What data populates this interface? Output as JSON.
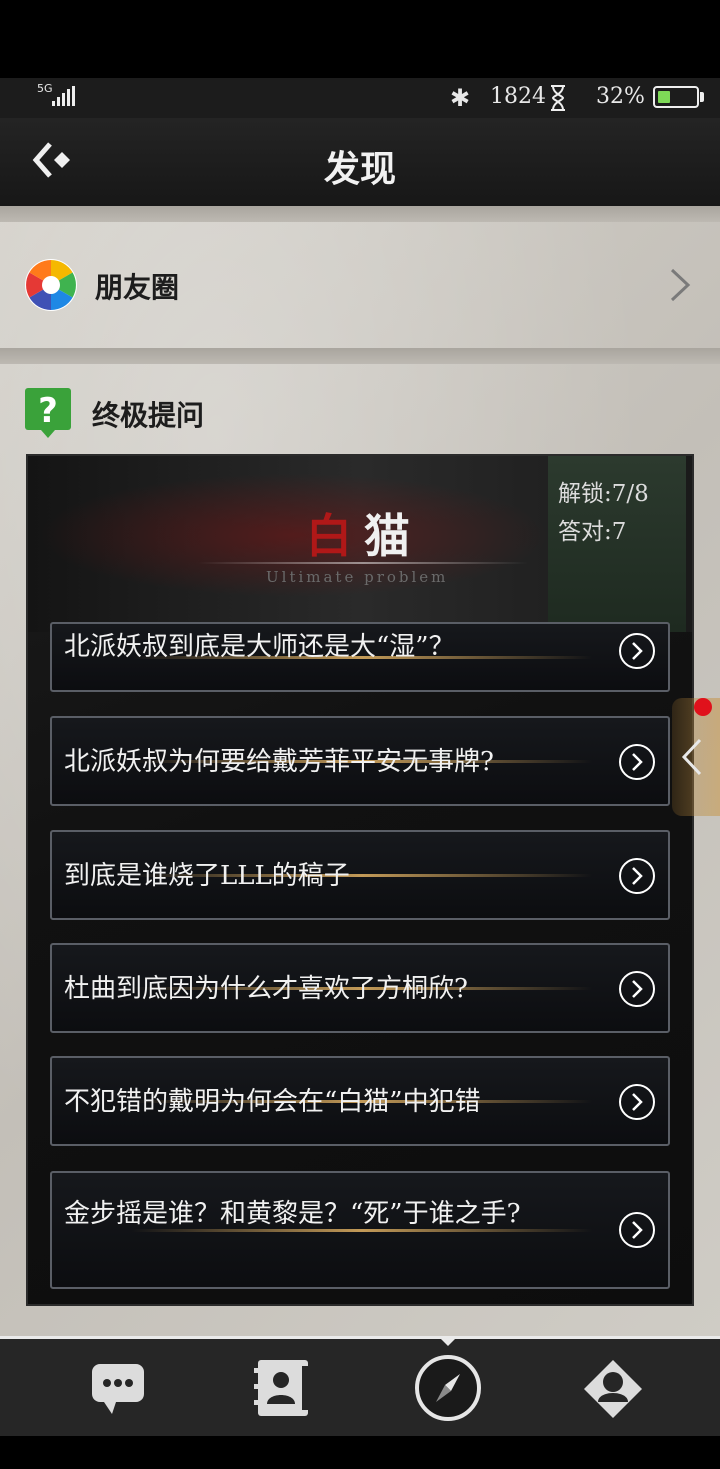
{
  "status_bar": {
    "network": "5G",
    "step_count": "1824",
    "battery_percent": "32%",
    "battery_level": 0.32,
    "battery_color": "#7ed957",
    "icons": [
      "signal-icon",
      "bluetooth-icon",
      "hourglass-icon",
      "battery-icon"
    ]
  },
  "header": {
    "title": "发现",
    "back_icon": "back-arrow-icon"
  },
  "moments": {
    "label": "朋友圈",
    "icon": "aperture-icon",
    "chevron": "chevron-right-icon"
  },
  "ultimate_question": {
    "section_label": "终极提问",
    "icon": "question-bubble-icon",
    "banner": {
      "title_part1": "白",
      "title_part2": "猫",
      "subtitle": "Ultimate problem",
      "unlocked": "解锁:7/8",
      "correct": "答对:7"
    },
    "questions": [
      {
        "text": "北派妖叔到底是大师还是大“湿”？"
      },
      {
        "text": "北派妖叔为何要给戴芳菲平安无事牌?"
      },
      {
        "text": "到底是谁烧了LLL的稿子"
      },
      {
        "text": "杜曲到底因为什么才喜欢了方桐欣?"
      },
      {
        "text": "不犯错的戴明为何会在“白猫”中犯错"
      },
      {
        "text": "金步摇是谁？和黄黎是？“死”于谁之手?"
      }
    ]
  },
  "side_tab": {
    "icon": "chevron-left-icon",
    "badge_color": "#e0111b"
  },
  "bottom_nav": {
    "items": [
      "chat-bubble-icon",
      "contacts-book-icon",
      "compass-icon",
      "profile-diamond-icon"
    ],
    "active_index": 2
  }
}
